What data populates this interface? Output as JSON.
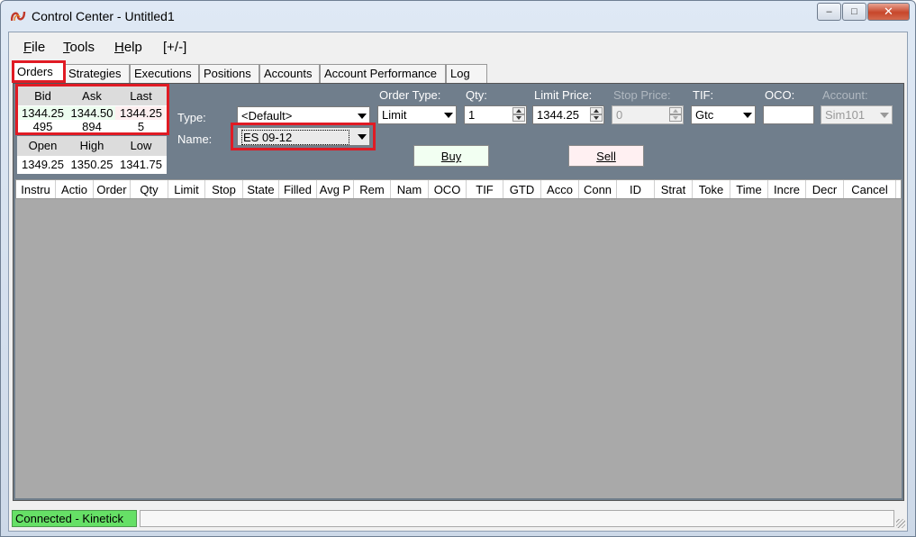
{
  "window": {
    "title": "Control Center - Untitled1",
    "minimize": "–",
    "maximize": "□",
    "close": "✕"
  },
  "menu": [
    {
      "label": "File",
      "mnemonic": "F",
      "rest": "ile"
    },
    {
      "label": "Tools",
      "mnemonic": "T",
      "rest": "ools"
    },
    {
      "label": "Help",
      "mnemonic": "H",
      "rest": "elp"
    },
    {
      "label": "[+/-]",
      "mnemonic": "",
      "rest": "[+/-]"
    }
  ],
  "tabs": [
    "Orders",
    "Strategies",
    "Executions",
    "Positions",
    "Accounts",
    "Account Performance",
    "Log"
  ],
  "quote": {
    "headers": [
      "Bid",
      "Ask",
      "Last"
    ],
    "prices": [
      "1344.25",
      "1344.50",
      "1344.25"
    ],
    "sizes": [
      "495",
      "894",
      "5"
    ],
    "ohl_headers": [
      "Open",
      "High",
      "Low"
    ],
    "ohl_values": [
      "1349.25",
      "1350.25",
      "1341.75"
    ]
  },
  "order_entry": {
    "type_label": "Type:",
    "type_value": "<Default>",
    "name_label": "Name:",
    "name_value": "ES 09-12",
    "order_type_label": "Order Type:",
    "order_type_value": "Limit",
    "qty_label": "Qty:",
    "qty_value": "1",
    "limit_price_label": "Limit Price:",
    "limit_price_value": "1344.25",
    "stop_price_label": "Stop Price:",
    "stop_price_value": "0",
    "tif_label": "TIF:",
    "tif_value": "Gtc",
    "oco_label": "OCO:",
    "oco_value": "",
    "account_label": "Account:",
    "account_value": "Sim101",
    "buy_label": "Buy",
    "sell_label": "Sell"
  },
  "grid": {
    "columns": [
      "Instru",
      "Actio",
      "Order",
      "Qty",
      "Limit",
      "Stop",
      "State",
      "Filled",
      "Avg P",
      "Rem",
      "Nam",
      "OCO",
      "TIF",
      "GTD",
      "Acco",
      "Conn",
      "ID",
      "Strat",
      "Toke",
      "Time",
      "Incre",
      "Decr",
      "Cancel"
    ]
  },
  "status": {
    "connection": "Connected - Kinetick"
  },
  "colors": {
    "panel": "#707e8c",
    "highlight": "#e01b24",
    "connected": "#66e066",
    "buy_bg": "#f2fff2",
    "sell_bg": "#fff0f2"
  }
}
